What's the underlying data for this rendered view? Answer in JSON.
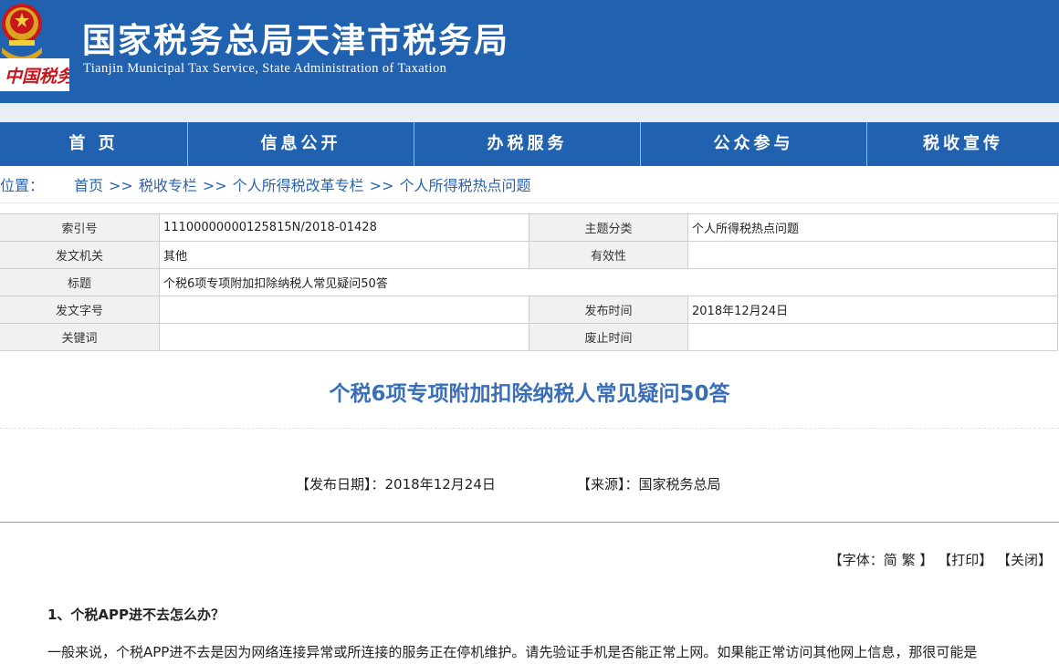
{
  "header": {
    "title": "国家税务总局天津市税务局",
    "subtitle": "Tianjin Municipal Tax Service, State Administration of Taxation",
    "logo_text": "中国税务",
    "colors": {
      "brand": "#2061b0",
      "link": "#2a63b0",
      "title": "#3a6fb8"
    }
  },
  "nav": [
    "首 页",
    "信息公开",
    "办税服务",
    "公众参与",
    "税收宣传"
  ],
  "breadcrumb": {
    "label": "位置：",
    "items": [
      "首页",
      "税收专栏",
      "个人所得税改革专栏",
      "个人所得税热点问题"
    ],
    "separator": ">>"
  },
  "info": {
    "index_label": "索引号",
    "index_value": "11100000000125815N/2018-01428",
    "topic_label": "主题分类",
    "topic_value": "个人所得税热点问题",
    "issuer_label": "发文机关",
    "issuer_value": "其他",
    "validity_label": "有效性",
    "validity_value": "",
    "title_label": "标题",
    "title_value": "个税6项专项附加扣除纳税人常见疑问50答",
    "doc_no_label": "发文字号",
    "doc_no_value": "",
    "publish_label": "发布时间",
    "publish_value": "2018年12月24日",
    "keywords_label": "关键词",
    "keywords_value": "",
    "abolish_label": "废止时间",
    "abolish_value": ""
  },
  "article": {
    "title": "个税6项专项附加扣除纳税人常见疑问50答",
    "date_label": "【发布日期】：",
    "date": "2018年12月24日",
    "source_label": "【来源】：",
    "source": "国家税务总局",
    "font_label": "【字体：",
    "font_simplified": "简",
    "font_traditional": "繁",
    "font_close": "】",
    "print": "【打印】",
    "close": "【关闭】",
    "q1": "1、个税APP进不去怎么办？",
    "p1": "一般来说，个税APP进不去是因为网络连接异常或所连接的服务正在停机维护。请先验证手机是否能正常上网。如果能正常访问其他网上信息，那很可能是"
  }
}
